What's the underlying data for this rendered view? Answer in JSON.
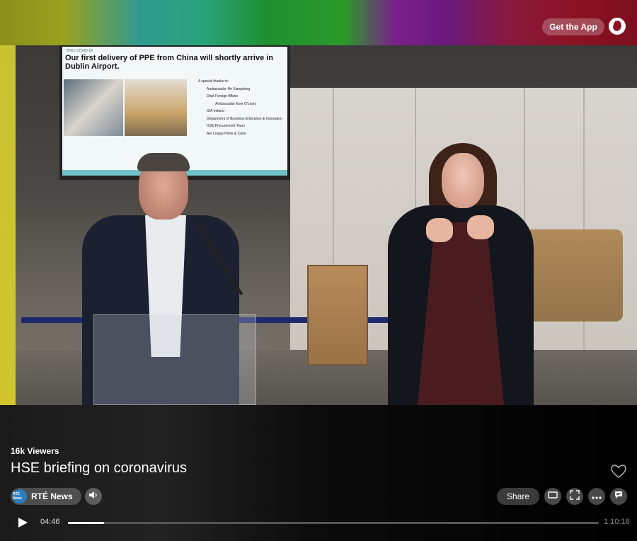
{
  "header": {
    "get_app_label": "Get the App",
    "logo_icon": "ireland-icon"
  },
  "slide": {
    "header_text": "RTE | COVID-19",
    "title": "Our first delivery of PPE from China will shortly arrive in Dublin Airport.",
    "thanks_heading": "A special thanks to:",
    "thanks": [
      "Ambassador He Xiangdong",
      "Dept Foreign Affairs",
      "Ambassador Eoin O'Leary",
      "IDA Ireland",
      "Department of Business Enterprise & Innovation",
      "HSE Procurement Team",
      "Aer Lingus Pilots & Crew"
    ]
  },
  "stream": {
    "viewers": "16k Viewers",
    "title": "HSE briefing on coronavirus",
    "channel_name": "RTÉ News",
    "channel_logo_text": "RTÉ News",
    "share_label": "Share"
  },
  "player": {
    "current_time": "04:46",
    "total_time": "1:10:18",
    "progress": 0.068
  },
  "icons": {
    "volume": "volume-icon",
    "heart": "heart-icon",
    "theater": "theater-mode-icon",
    "fullscreen": "fullscreen-icon",
    "more": "more-options-icon",
    "chat": "chat-icon",
    "play": "play-icon"
  }
}
